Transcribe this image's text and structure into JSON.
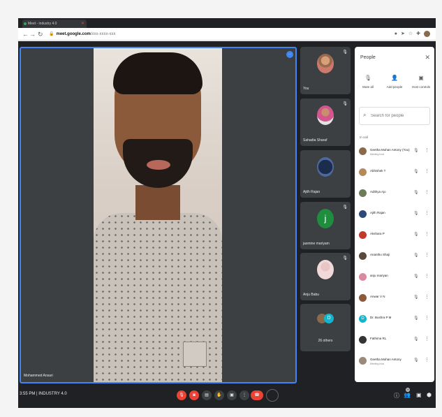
{
  "browser": {
    "tab_title": "Meet - industry 4.0",
    "url_bold": "meet.google.com",
    "url_rest": "/xxx-xxxx-xxx"
  },
  "main_speaker": {
    "name": "Mohammed Ansari"
  },
  "side_tiles": [
    {
      "name": "You"
    },
    {
      "name": "Sahadia Sharaf"
    },
    {
      "name": "Ajith Rajan"
    },
    {
      "name": "jasmine mariyam",
      "letter": "j"
    },
    {
      "name": "Anju Babu"
    }
  ],
  "others_tile": {
    "label": "26 others",
    "letter": "D"
  },
  "people_panel": {
    "title": "People",
    "actions": [
      "Mute all",
      "Add people",
      "Host controls"
    ],
    "search_placeholder": "Search for people",
    "section": "In call",
    "participants": [
      {
        "name": "Geetha Mohan Antony (You)",
        "sub": "Meeting host",
        "letter": ""
      },
      {
        "name": "Abhishek T",
        "sub": "",
        "letter": ""
      },
      {
        "name": "Adithya Ajo",
        "sub": "",
        "letter": ""
      },
      {
        "name": "Ajith Rajan",
        "sub": "",
        "letter": ""
      },
      {
        "name": "Akshara P",
        "sub": "",
        "letter": ""
      },
      {
        "name": "Ananthu Shaji",
        "sub": "",
        "letter": ""
      },
      {
        "name": "anju mariyan",
        "sub": "",
        "letter": ""
      },
      {
        "name": "Anwar V N",
        "sub": "",
        "letter": ""
      },
      {
        "name": "Dr. Bushra P M",
        "sub": "",
        "letter": "D"
      },
      {
        "name": "Fathima RL",
        "sub": "",
        "letter": ""
      },
      {
        "name": "Geetha Mohan Antony",
        "sub": "Meeting host",
        "letter": ""
      }
    ]
  },
  "bottom_bar": {
    "clock": "3:55 PM",
    "divider": "|",
    "meeting_name": "INDUSTRY 4.0",
    "participant_count": "30"
  },
  "colors": {
    "accent": "#4285f4",
    "danger": "#ea4335",
    "tile": "#3c4043",
    "background": "#202124"
  }
}
